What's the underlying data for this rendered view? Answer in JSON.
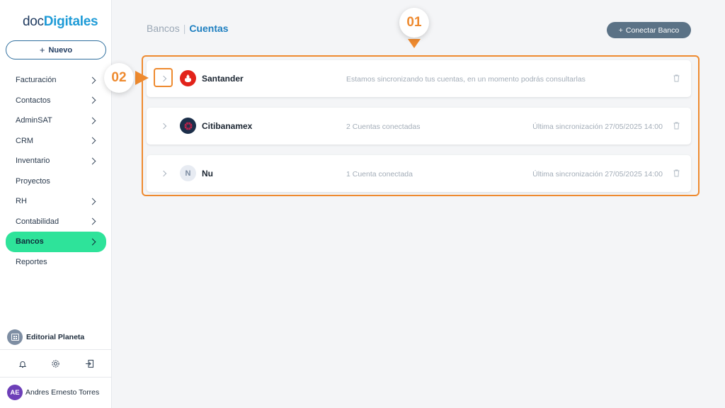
{
  "app": {
    "logo_doc": "doc",
    "logo_digitales": "Digitales"
  },
  "sidebar": {
    "new_button": "Nuevo",
    "items": [
      {
        "label": "Facturación",
        "has_chevron": true
      },
      {
        "label": "Contactos",
        "has_chevron": true
      },
      {
        "label": "AdminSAT",
        "has_chevron": true
      },
      {
        "label": "CRM",
        "has_chevron": true
      },
      {
        "label": "Inventario",
        "has_chevron": true
      },
      {
        "label": "Proyectos",
        "has_chevron": false
      },
      {
        "label": "RH",
        "has_chevron": true
      },
      {
        "label": "Contabilidad",
        "has_chevron": true
      },
      {
        "label": "Bancos",
        "has_chevron": true,
        "active": true
      },
      {
        "label": "Reportes",
        "has_chevron": false
      }
    ],
    "company": "Editorial Planeta",
    "bottom_icons": [
      "bell-icon",
      "gear-icon",
      "logout-icon"
    ],
    "user": {
      "initials": "AE",
      "name": "Andres Ernesto Torres"
    }
  },
  "header": {
    "breadcrumb_parent": "Bancos",
    "breadcrumb_separator": "|",
    "breadcrumb_current": "Cuentas",
    "connect_button": "Conectar Banco"
  },
  "banks": [
    {
      "name": "Santander",
      "status": "Estamos sincronizando tus cuentas, en un momento podrás consultarlas",
      "sync": "",
      "logo": "santander-logo"
    },
    {
      "name": "Citibanamex",
      "status": "2 Cuentas conectadas",
      "sync": "Última sincronización 27/05/2025 14:00",
      "logo": "citibanamex-logo"
    },
    {
      "name": "Nu",
      "status": "1 Cuenta conectada",
      "sync": "Última sincronización 27/05/2025 14:00",
      "logo": "nu-logo",
      "logo_letter": "N"
    }
  ],
  "annotations": {
    "badge1": "01",
    "badge2": "02"
  },
  "colors": {
    "accent": "#2ee39a",
    "annotation": "#ee8a2f",
    "brand_blue": "#1e7fc0",
    "connect_button": "#5b7286"
  }
}
